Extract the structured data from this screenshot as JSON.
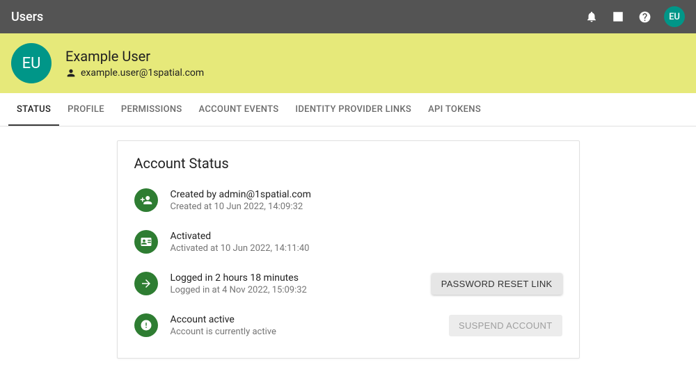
{
  "topbar": {
    "title": "Users",
    "avatar_initials": "EU"
  },
  "user": {
    "avatar_initials": "EU",
    "name": "Example User",
    "email": "example.user@1spatial.com"
  },
  "tabs": [
    {
      "label": "STATUS",
      "active": true
    },
    {
      "label": "PROFILE",
      "active": false
    },
    {
      "label": "PERMISSIONS",
      "active": false
    },
    {
      "label": "ACCOUNT EVENTS",
      "active": false
    },
    {
      "label": "IDENTITY PROVIDER LINKS",
      "active": false
    },
    {
      "label": "API TOKENS",
      "active": false
    }
  ],
  "status": {
    "heading": "Account Status",
    "created": {
      "primary": "Created by admin@1spatial.com",
      "secondary": "Created at 10 Jun 2022, 14:09:32"
    },
    "activated": {
      "primary": "Activated",
      "secondary": "Activated at 10 Jun 2022, 14:11:40"
    },
    "loggedin": {
      "primary": "Logged in 2 hours 18 minutes",
      "secondary": "Logged in at 4 Nov 2022, 15:09:32"
    },
    "active": {
      "primary": "Account active",
      "secondary": "Account is currently active"
    },
    "buttons": {
      "password_reset": "PASSWORD RESET LINK",
      "suspend": "SUSPEND ACCOUNT"
    }
  }
}
